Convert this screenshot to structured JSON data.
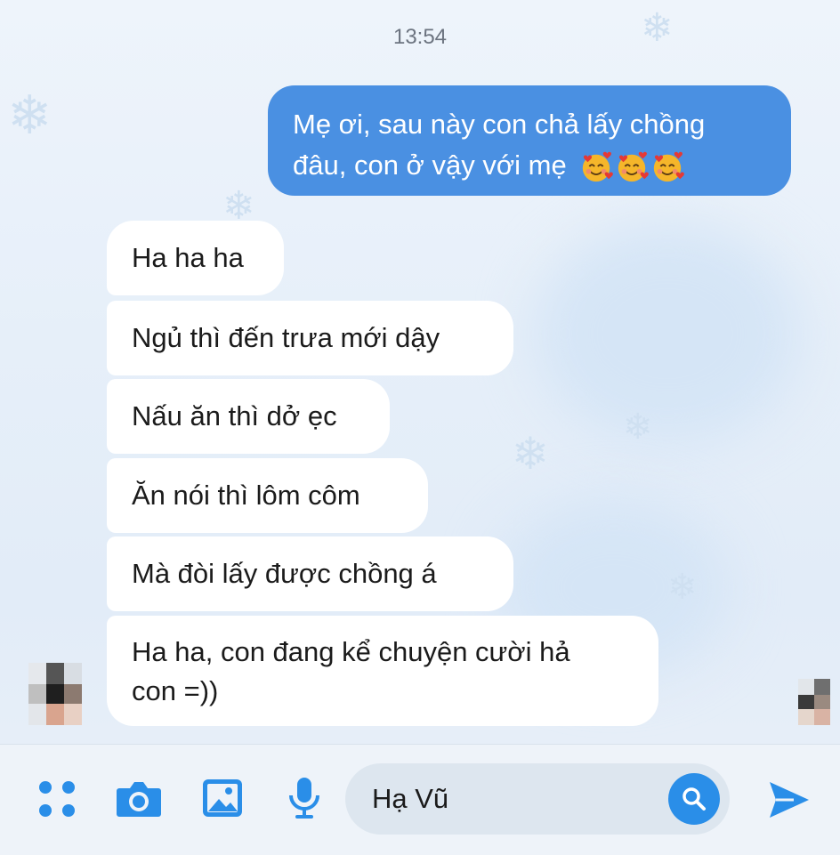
{
  "conversation": {
    "timestamp": "13:54",
    "outgoing": {
      "line1": "Mẹ ơi, sau này con chả lấy chồng",
      "line2": "đâu, con ở vậy với mẹ",
      "emoji": [
        "smiling-face-with-hearts-emoji",
        "smiling-face-with-hearts-emoji",
        "smiling-face-with-hearts-emoji"
      ]
    },
    "incoming": [
      "Ha ha ha",
      "Ngủ thì đến trưa mới dậy",
      "Nấu ăn thì dở ẹc",
      "Ăn nói thì lôm côm",
      "Mà đòi lấy được chồng á",
      "Ha ha, con đang kể chuyện cười hả con =))"
    ],
    "incoming_last_line1": "Ha ha, con đang kể chuyện cười hả",
    "incoming_last_line2": "con =))"
  },
  "composer": {
    "icons": [
      "apps-grid-icon",
      "camera-icon",
      "image-icon",
      "microphone-icon",
      "search-icon",
      "send-icon"
    ],
    "input_value": "Hạ Vũ"
  },
  "colors": {
    "accent": "#4a90e2",
    "incoming_bubble": "#ffffff",
    "search_button": "#2a8ee8",
    "background": "#e6eff9"
  }
}
